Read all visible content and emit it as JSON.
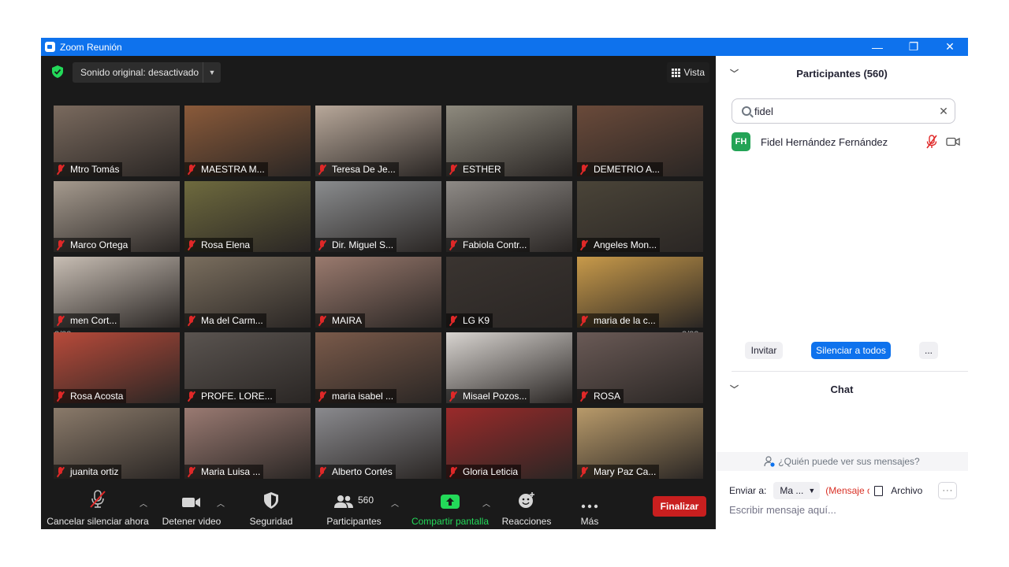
{
  "window": {
    "title": "Zoom Reunión",
    "controls": {
      "minimize": "—",
      "restore": "❐",
      "close": "✕"
    }
  },
  "stage": {
    "sound_button": "Sonido original: desactivado",
    "view_button": "Vista",
    "page_left": "2/23",
    "page_right": "2/23"
  },
  "participants_grid": [
    {
      "name": "Mtro Tomás",
      "bg": "#7a6a5e"
    },
    {
      "name": "MAESTRA M...",
      "bg": "#8a5a3a"
    },
    {
      "name": "Teresa De Je...",
      "bg": "#b8a89a"
    },
    {
      "name": "ESTHER",
      "bg": "#8e8a7e"
    },
    {
      "name": "DEMETRIO A...",
      "bg": "#6a4a3a"
    },
    {
      "name": "Marco Ortega",
      "bg": "#a59a8e"
    },
    {
      "name": "Rosa Elena",
      "bg": "#6e6a3e"
    },
    {
      "name": "Dir. Miguel S...",
      "bg": "#8a8c8e"
    },
    {
      "name": "Fabiola Contr...",
      "bg": "#8e8a86"
    },
    {
      "name": "Angeles Mon...",
      "bg": "#4a4438"
    },
    {
      "name": "men Cort...",
      "bg": "#c8beb4"
    },
    {
      "name": "Ma del Carm...",
      "bg": "#7a6e5e"
    },
    {
      "name": "MAIRA",
      "bg": "#9a7a6e"
    },
    {
      "name": "LG K9",
      "bg": "#3a3430"
    },
    {
      "name": "maria de la c...",
      "bg": "#c89a4a"
    },
    {
      "name": "Rosa Acosta",
      "bg": "#b84a3a"
    },
    {
      "name": "PROFE. LORE...",
      "bg": "#5a5450"
    },
    {
      "name": "maria isabel ...",
      "bg": "#7a5a4a"
    },
    {
      "name": "Misael Pozos...",
      "bg": "#d8d4d0"
    },
    {
      "name": "ROSA",
      "bg": "#6a5a56"
    },
    {
      "name": "juanita ortiz",
      "bg": "#8a7a6a"
    },
    {
      "name": "Maria Luisa ...",
      "bg": "#9a7a72"
    },
    {
      "name": "Alberto Cortés",
      "bg": "#8a8a8e"
    },
    {
      "name": "Gloria Leticia",
      "bg": "#9a2a2a"
    },
    {
      "name": "Mary Paz Ca...",
      "bg": "#b89a6a"
    }
  ],
  "toolbar": {
    "mute_label": "Cancelar silenciar ahora",
    "video_label": "Detener video",
    "security_label": "Seguridad",
    "participants_label": "Participantes",
    "participants_count": "560",
    "share_label": "Compartir pantalla",
    "reactions_label": "Reacciones",
    "more_label": "Más",
    "end_label": "Finalizar"
  },
  "sidebar": {
    "participants_title": "Participantes (560)",
    "search_value": "fidel",
    "result": {
      "initials": "FH",
      "name": "Fidel Hernández Fernández"
    },
    "invite_label": "Invitar",
    "mute_all_label": "Silenciar a todos",
    "more_label": "...",
    "chat_title": "Chat",
    "who_can_see": "¿Quién puede ver sus mensajes?",
    "send_to_label": "Enviar a:",
    "send_to_value": "Ma ...",
    "private_label": "(Mensaje c",
    "file_label": "Archivo",
    "chat_more": "···",
    "message_placeholder": "Escribir mensaje aquí..."
  },
  "colors": {
    "titlebar": "#0e72ed",
    "stage_bg": "#1a1a1a",
    "share_green": "#23d959",
    "end_red": "#c91f1f",
    "mute_red": "#e02828",
    "arrow_blue": "#1a9bff",
    "avatar_green": "#23a356"
  }
}
